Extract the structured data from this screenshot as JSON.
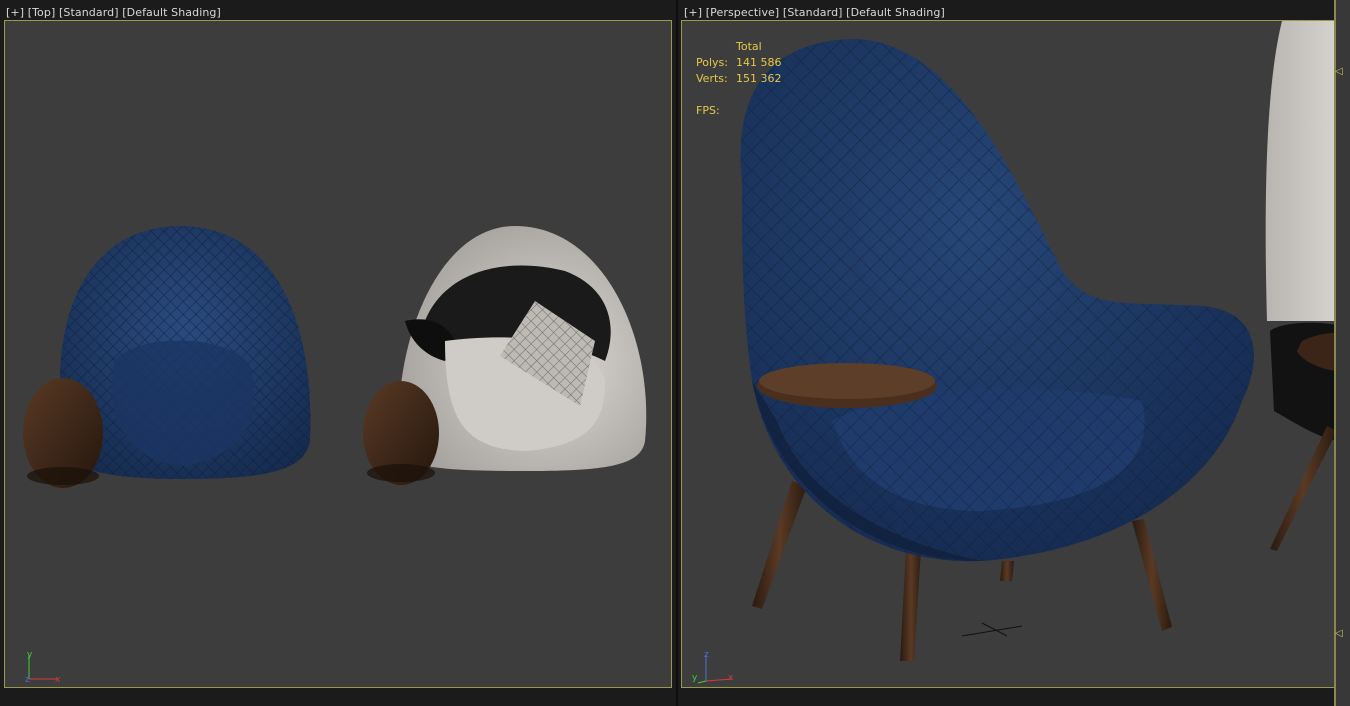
{
  "left_viewport": {
    "menu": "[+]",
    "view": "[Top]",
    "mode": "[Standard]",
    "shading": "[Default Shading]"
  },
  "right_viewport": {
    "menu": "[+]",
    "view": "[Perspective]",
    "mode": "[Standard]",
    "shading": "[Default Shading]",
    "stats": {
      "header": "Total",
      "polys_label": "Polys:",
      "polys_value": "141 586",
      "verts_label": "Verts:",
      "verts_value": "151 362",
      "fps_label": "FPS:",
      "fps_value": ""
    }
  },
  "gizmo_left": {
    "y": "y",
    "z": "z",
    "x": "x"
  },
  "gizmo_right": {
    "z": "z",
    "y": "y",
    "x": "x"
  },
  "colors": {
    "viewport_bg": "#3d3d3d",
    "active_border": "#9c9a4a",
    "stats_text": "#e6c84a",
    "chair_blue": "#1f3a66",
    "chair_white": "#c9c6c2",
    "wood": "#3a2418"
  }
}
